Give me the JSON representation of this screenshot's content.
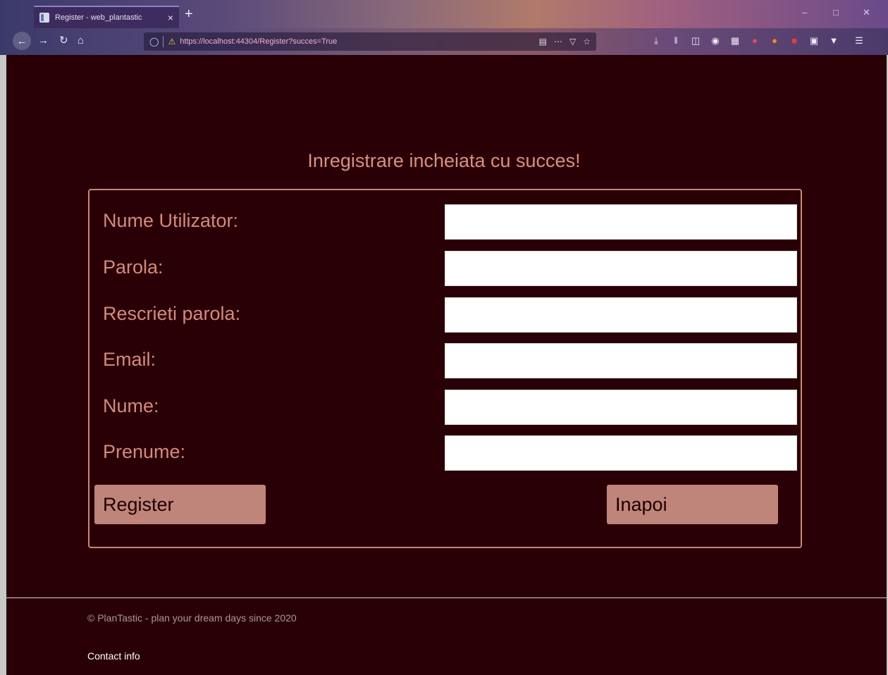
{
  "browser": {
    "tab_title": "Register - web_plantastic",
    "tab_close": "×",
    "new_tab": "+",
    "url": "https://localhost:44304/Register?succes=True"
  },
  "page": {
    "success_message": "Inregistrare incheiata cu succes!",
    "form": {
      "fields": [
        {
          "label": "Nume Utilizator:",
          "value": ""
        },
        {
          "label": "Parola:",
          "value": ""
        },
        {
          "label": "Rescrieti parola:",
          "value": ""
        },
        {
          "label": "Email:",
          "value": ""
        },
        {
          "label": "Nume:",
          "value": ""
        },
        {
          "label": "Prenume:",
          "value": ""
        }
      ],
      "register_label": "Register",
      "back_label": "Inapoi"
    },
    "footer": {
      "copyright": "© PlanTastic - plan your dream days since 2020",
      "contact": "Contact info"
    }
  }
}
